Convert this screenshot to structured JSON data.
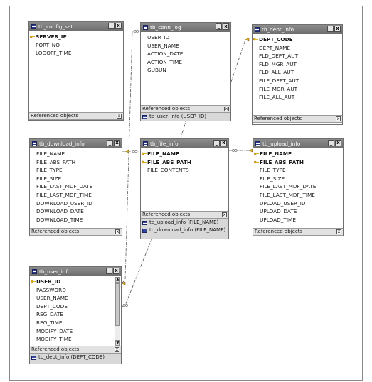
{
  "tables": {
    "tb_config_set": {
      "title": "tb_config_set",
      "fields": [
        "SERVER_IP",
        "PORT_NO",
        "LOGOFF_TIME"
      ],
      "pk_count": 1,
      "ref_label": "Referenced objects",
      "refs": []
    },
    "tb_conn_log": {
      "title": "tb_conn_log",
      "fields": [
        "USER_ID",
        "USER_NAME",
        "ACTION_DATE",
        "ACTION_TIME",
        "GUBUN"
      ],
      "pk_count": 0,
      "ref_label": "Referenced objects",
      "refs": [
        "tb_user_info (USER_ID)"
      ]
    },
    "tb_dept_info": {
      "title": "tb_dept_info",
      "fields": [
        "DEPT_CODE",
        "DEPT_NAME",
        "FLD_DEPT_AUT",
        "FLD_MGR_AUT",
        "FLD_ALL_AUT",
        "FILE_DEPT_AUT",
        "FILE_MGR_AUT",
        "FILE_ALL_AUT"
      ],
      "pk_count": 1,
      "ref_label": "Referenced objects",
      "refs": []
    },
    "tb_download_info": {
      "title": "tb_download_info",
      "fields": [
        "FILE_NAME",
        "FILE_ABS_PATH",
        "FILE_TYPE",
        "FILE_SIZE",
        "FILE_LAST_MDF_DATE",
        "FILE_LAST_MDF_TIME",
        "DOWNLOAD_USER_ID",
        "DOWNLOAD_DATE",
        "DOWNLOAD_TIME"
      ],
      "pk_count": 0,
      "ref_label": "Referenced objects",
      "refs": []
    },
    "tb_file_info": {
      "title": "tb_file_info",
      "fields": [
        "FILE_NAME",
        "FILE_ABS_PATH",
        "FILE_CONTENTS"
      ],
      "pk_count": 2,
      "ref_label": "Referenced objects",
      "refs": [
        "tb_upload_info (FILE_NAME)",
        "tb_download_info (FILE_NAME)"
      ]
    },
    "tb_upload_info": {
      "title": "tb_upload_info",
      "fields": [
        "FILE_NAME",
        "FILE_ABS_PATH",
        "FILE_TYPE",
        "FILE_SIZE",
        "FILE_LAST_MDF_DATE",
        "FILE_LAST_MDF_TIME",
        "UPLOAD_USER_ID",
        "UPLOAD_DATE",
        "UPLOAD_TIME"
      ],
      "pk_count": 2,
      "ref_label": "Referenced objects",
      "refs": []
    },
    "tb_user_info": {
      "title": "tb_user_info",
      "fields": [
        "USER_ID",
        "PASSWORD",
        "USER_NAME",
        "DEPT_CODE",
        "REG_DATE",
        "REG_TIME",
        "MODIFY_DATE",
        "MODIFY_TIME"
      ],
      "pk_count": 1,
      "ref_label": "Referenced objects",
      "refs": [
        "tb_dept_info (DEPT_CODE)"
      ]
    }
  },
  "window_buttons": {
    "minimize": "_",
    "close": "x"
  },
  "ref_close": "x",
  "colors": {
    "title_bar": "#7d7d7d",
    "ref_area": "#d8d8d8",
    "key_icon": "#e3b01c",
    "table_icon": "#2b3a8c",
    "connector": "#555555"
  },
  "icons": [
    "table-icon",
    "primary-key-icon",
    "minimize-icon",
    "close-icon",
    "referenced-table-icon"
  ]
}
